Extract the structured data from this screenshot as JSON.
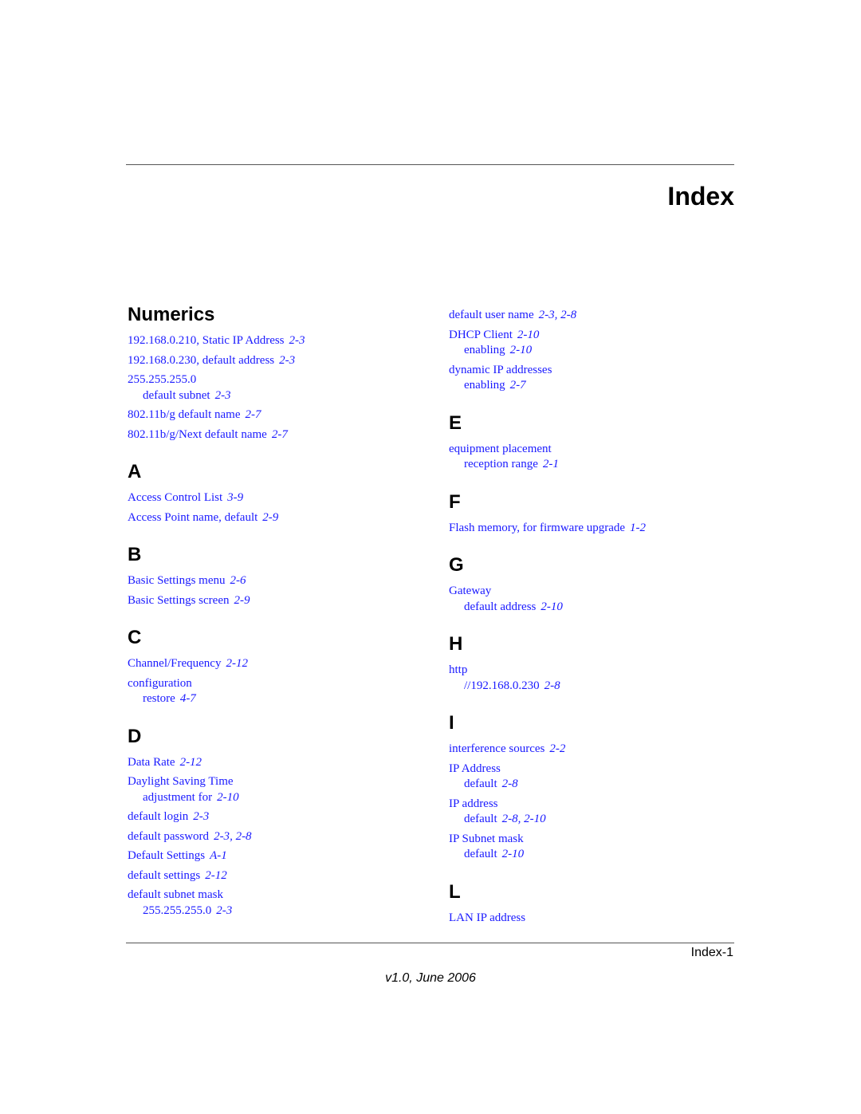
{
  "header": {
    "title": "Index"
  },
  "colors": {
    "link": "#1a1aff",
    "heading": "#000000",
    "rule": "#555555"
  },
  "left_column": [
    {
      "letter": "Numerics",
      "entries": [
        {
          "text": "192.168.0.210, Static IP Address",
          "pages": [
            "2-3"
          ]
        },
        {
          "text": "192.168.0.230, default address",
          "pages": [
            "2-3"
          ]
        },
        {
          "text": "255.255.255.0",
          "pages": [],
          "sub": {
            "text": "default subnet",
            "pages": [
              "2-3"
            ]
          }
        },
        {
          "text": "802.11b/g default name",
          "pages": [
            "2-7"
          ]
        },
        {
          "text": "802.11b/g/Next default name",
          "pages": [
            "2-7"
          ]
        }
      ]
    },
    {
      "letter": "A",
      "entries": [
        {
          "text": "Access Control List",
          "pages": [
            "3-9"
          ]
        },
        {
          "text": "Access Point name, default",
          "pages": [
            "2-9"
          ]
        }
      ]
    },
    {
      "letter": "B",
      "entries": [
        {
          "text": "Basic Settings menu",
          "pages": [
            "2-6"
          ]
        },
        {
          "text": "Basic Settings screen",
          "pages": [
            "2-9"
          ]
        }
      ]
    },
    {
      "letter": "C",
      "entries": [
        {
          "text": "Channel/Frequency",
          "pages": [
            "2-12"
          ]
        },
        {
          "text": "configuration",
          "pages": [],
          "sub": {
            "text": "restore",
            "pages": [
              "4-7"
            ]
          }
        }
      ]
    },
    {
      "letter": "D",
      "entries": [
        {
          "text": "Data Rate",
          "pages": [
            "2-12"
          ]
        },
        {
          "text": "Daylight Saving Time",
          "pages": [],
          "sub": {
            "text": "adjustment for",
            "pages": [
              "2-10"
            ]
          }
        },
        {
          "text": "default login",
          "pages": [
            "2-3"
          ]
        },
        {
          "text": "default password",
          "pages": [
            "2-3",
            "2-8"
          ]
        },
        {
          "text": "Default Settings",
          "pages": [
            "A-1"
          ]
        },
        {
          "text": "default settings",
          "pages": [
            "2-12"
          ]
        },
        {
          "text": "default subnet mask",
          "pages": [],
          "sub": {
            "text": "255.255.255.0",
            "pages": [
              "2-3"
            ]
          }
        }
      ]
    }
  ],
  "right_column": [
    {
      "letter": "",
      "entries": [
        {
          "text": "default user name",
          "pages": [
            "2-3",
            "2-8"
          ]
        },
        {
          "text": "DHCP Client",
          "pages": [
            "2-10"
          ],
          "sub": {
            "text": "enabling",
            "pages": [
              "2-10"
            ]
          }
        },
        {
          "text": "dynamic IP addresses",
          "pages": [],
          "sub": {
            "text": "enabling",
            "pages": [
              "2-7"
            ]
          }
        }
      ]
    },
    {
      "letter": "E",
      "entries": [
        {
          "text": "equipment placement",
          "pages": [],
          "sub": {
            "text": "reception range",
            "pages": [
              "2-1"
            ]
          }
        }
      ]
    },
    {
      "letter": "F",
      "entries": [
        {
          "text": "Flash memory, for firmware upgrade",
          "pages": [
            "1-2"
          ]
        }
      ]
    },
    {
      "letter": "G",
      "entries": [
        {
          "text": "Gateway",
          "pages": [],
          "sub": {
            "text": "default address",
            "pages": [
              "2-10"
            ]
          }
        }
      ]
    },
    {
      "letter": "H",
      "entries": [
        {
          "text": "http",
          "pages": [],
          "sub": {
            "text": "//192.168.0.230",
            "pages": [
              "2-8"
            ]
          }
        }
      ]
    },
    {
      "letter": "I",
      "entries": [
        {
          "text": "interference sources",
          "pages": [
            "2-2"
          ]
        },
        {
          "text": "IP Address",
          "pages": [],
          "sub": {
            "text": "default",
            "pages": [
              "2-8"
            ]
          }
        },
        {
          "text": "IP address",
          "pages": [],
          "sub": {
            "text": "default",
            "pages": [
              "2-8",
              "2-10"
            ]
          }
        },
        {
          "text": "IP Subnet mask",
          "pages": [],
          "sub": {
            "text": "default",
            "pages": [
              "2-10"
            ]
          }
        }
      ]
    },
    {
      "letter": "L",
      "entries": [
        {
          "text": "LAN IP address",
          "pages": []
        }
      ]
    }
  ],
  "footer": {
    "page_label": "Index-1",
    "version": "v1.0, June 2006"
  }
}
